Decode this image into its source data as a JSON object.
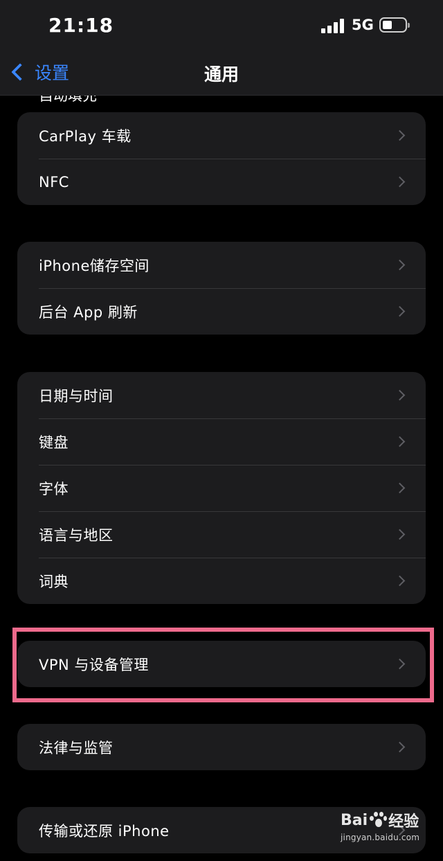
{
  "status_bar": {
    "time": "21:18",
    "network": "5G"
  },
  "nav": {
    "back_label": "设置",
    "title": "通用"
  },
  "partial_row_label": "自动填充",
  "groups": [
    {
      "rows": [
        "CarPlay 车载",
        "NFC"
      ]
    },
    {
      "rows": [
        "iPhone储存空间",
        "后台 App 刷新"
      ]
    },
    {
      "rows": [
        "日期与时间",
        "键盘",
        "字体",
        "语言与地区",
        "词典"
      ]
    },
    {
      "rows": [
        "VPN 与设备管理"
      ]
    },
    {
      "rows": [
        "法律与监管"
      ]
    },
    {
      "rows": [
        "传输或还原 iPhone"
      ]
    }
  ],
  "highlight_color": "#ee6a8c",
  "watermark": {
    "brand": "Bai",
    "brand_cn": "经验",
    "url": "jingyan.baidu.com"
  }
}
